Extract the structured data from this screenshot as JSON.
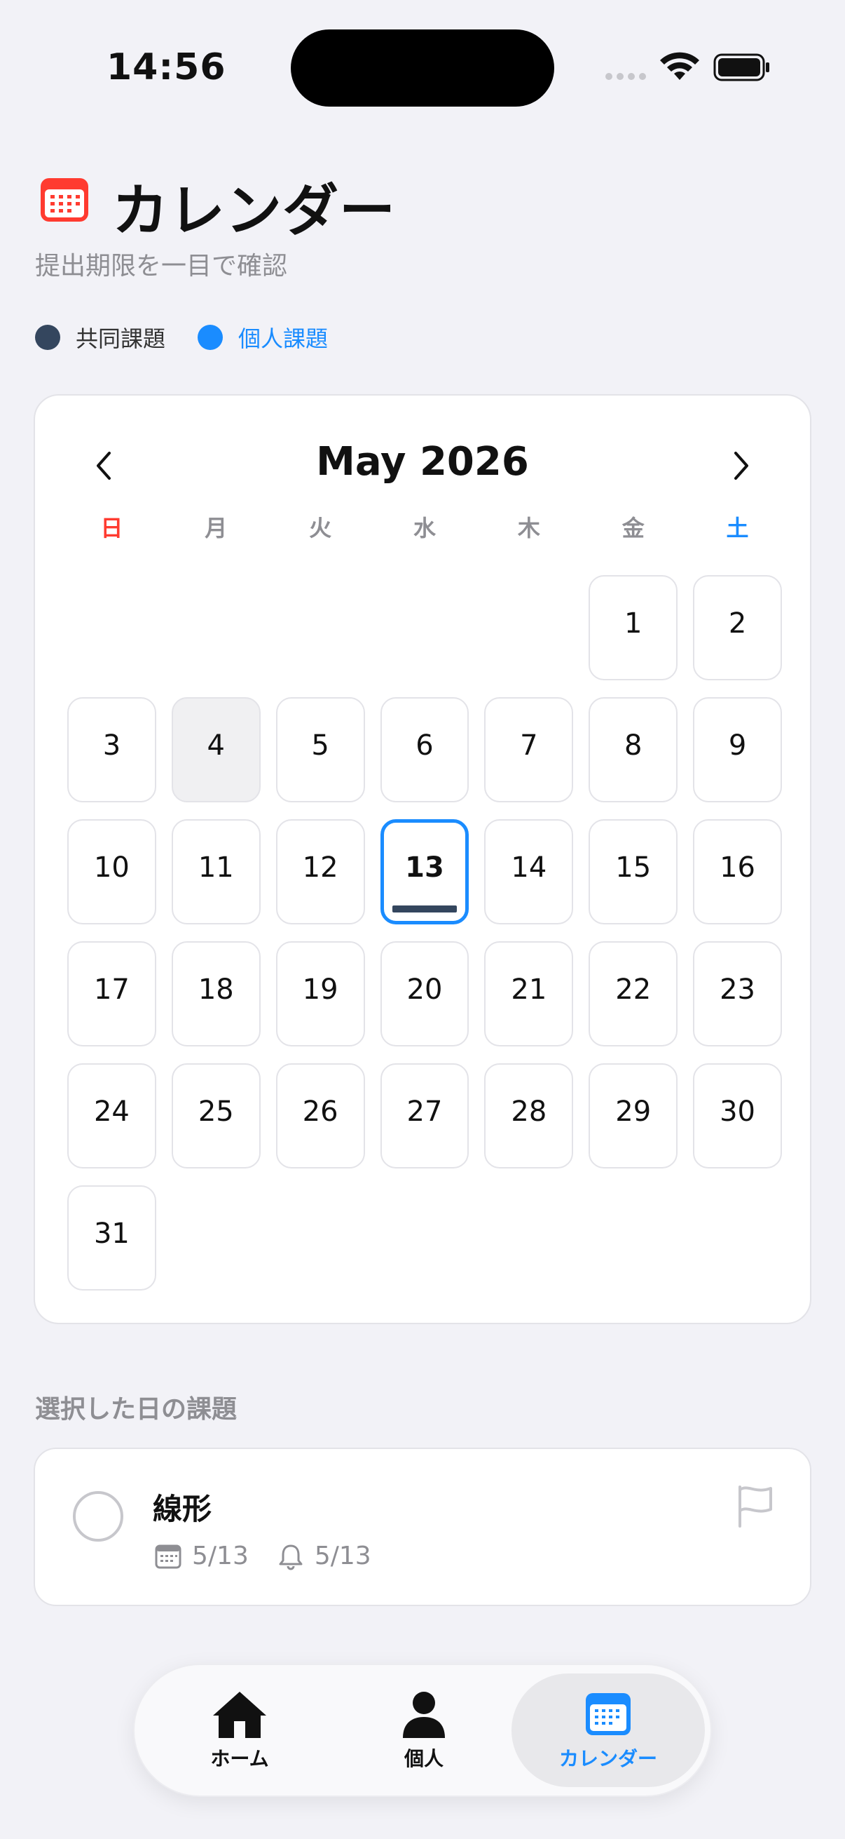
{
  "status_bar": {
    "time": "14:56"
  },
  "header": {
    "title": "カレンダー",
    "subtitle": "提出期限を一目で確認"
  },
  "legend": [
    {
      "label": "共同課題",
      "color": "#34465e"
    },
    {
      "label": "個人課題",
      "color": "#1a8cff"
    }
  ],
  "calendar": {
    "month_label": "May 2026",
    "weekdays": [
      "日",
      "月",
      "火",
      "水",
      "木",
      "金",
      "土"
    ],
    "weekday_colors": [
      "#ff3b30",
      "#8e8e93",
      "#8e8e93",
      "#8e8e93",
      "#8e8e93",
      "#8e8e93",
      "#1a8cff"
    ],
    "days": [
      "",
      "",
      "",
      "",
      "",
      "1",
      "2",
      "3",
      "4",
      "5",
      "6",
      "7",
      "8",
      "9",
      "10",
      "11",
      "12",
      "13",
      "14",
      "15",
      "16",
      "17",
      "18",
      "19",
      "20",
      "21",
      "22",
      "23",
      "24",
      "25",
      "26",
      "27",
      "28",
      "29",
      "30",
      "31"
    ],
    "selected_day": "13",
    "muted_day": "4"
  },
  "selected_section": {
    "label": "選択した日の課題",
    "task": {
      "title": "線形",
      "due": "5/13",
      "reminder": "5/13"
    }
  },
  "tabs": [
    {
      "label": "ホーム",
      "icon": "home-icon"
    },
    {
      "label": "個人",
      "icon": "person-icon"
    },
    {
      "label": "カレンダー",
      "icon": "calendar-icon",
      "active": true
    }
  ],
  "colors": {
    "accent": "#1a8cff",
    "shared": "#34465e",
    "title_icon": "#ff3b30"
  }
}
